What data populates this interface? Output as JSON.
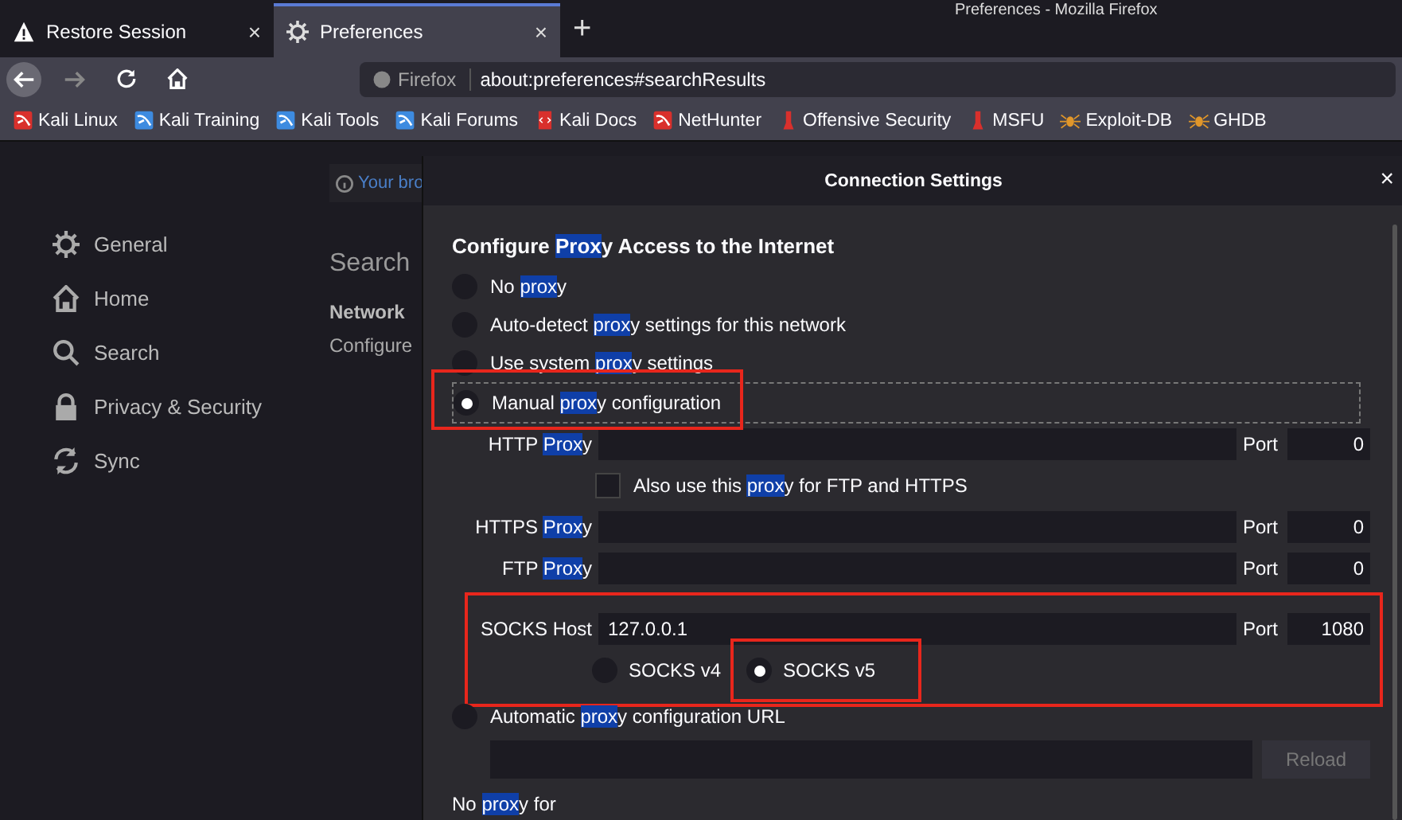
{
  "window": {
    "title": "Preferences - Mozilla Firefox"
  },
  "tabs": [
    {
      "label": "Restore Session",
      "kind": "warning",
      "selected": false,
      "close": "×"
    },
    {
      "label": "Preferences",
      "kind": "gear",
      "selected": true,
      "close": "×"
    }
  ],
  "new_tab": "+",
  "url_bar": {
    "identity": "Firefox",
    "url": "about:preferences#searchResults"
  },
  "bookmarks": [
    {
      "label": "Kali Linux",
      "kind": "dragon",
      "color": "#d9302c"
    },
    {
      "label": "Kali Training",
      "kind": "dragon",
      "color": "#3d8be0"
    },
    {
      "label": "Kali Tools",
      "kind": "dragon",
      "color": "#3d8be0"
    },
    {
      "label": "Kali Forums",
      "kind": "dragon",
      "color": "#3d8be0"
    },
    {
      "label": "Kali Docs",
      "kind": "doc",
      "color": "#d9302c"
    },
    {
      "label": "NetHunter",
      "kind": "dragon",
      "color": "#d9302c"
    },
    {
      "label": "Offensive Security",
      "kind": "flask",
      "color": "#d9302c"
    },
    {
      "label": "MSFU",
      "kind": "flask",
      "color": "#d9302c"
    },
    {
      "label": "Exploit-DB",
      "kind": "bug",
      "color": "#e0962a"
    },
    {
      "label": "GHDB",
      "kind": "bug",
      "color": "#e0962a"
    }
  ],
  "sidebar": {
    "items": [
      {
        "label": "General",
        "kind": "gear"
      },
      {
        "label": "Home",
        "kind": "home"
      },
      {
        "label": "Search",
        "kind": "search"
      },
      {
        "label": "Privacy & Security",
        "kind": "lock"
      },
      {
        "label": "Sync",
        "kind": "sync"
      }
    ]
  },
  "page": {
    "notice": "Your bro",
    "heading": "Search",
    "section": "Network",
    "description": "Configure"
  },
  "dialog": {
    "title": "Connection Settings",
    "close": "×",
    "heading": [
      {
        "text": "Configure ",
        "highlight": false
      },
      {
        "text": "Prox",
        "highlight": true
      },
      {
        "text": "y Access to the Internet",
        "highlight": false
      }
    ],
    "modes": [
      {
        "parts": [
          {
            "text": "No ",
            "highlight": false
          },
          {
            "text": "prox",
            "highlight": true
          },
          {
            "text": "y",
            "highlight": false
          }
        ],
        "selected": false,
        "outlined": false
      },
      {
        "parts": [
          {
            "text": "Auto-detect ",
            "highlight": false
          },
          {
            "text": "prox",
            "highlight": true
          },
          {
            "text": "y settings for this network",
            "highlight": false
          }
        ],
        "selected": false,
        "outlined": false
      },
      {
        "parts": [
          {
            "text": "Use system ",
            "highlight": false
          },
          {
            "text": "prox",
            "highlight": true
          },
          {
            "text": "y settings",
            "highlight": false
          }
        ],
        "selected": false,
        "outlined": false
      },
      {
        "parts": [
          {
            "text": "Manual ",
            "highlight": false
          },
          {
            "text": "prox",
            "highlight": true
          },
          {
            "text": "y configuration",
            "highlight": false
          }
        ],
        "selected": true,
        "outlined": true
      }
    ],
    "http": {
      "label": [
        {
          "text": "HTTP ",
          "highlight": false
        },
        {
          "text": "Prox",
          "highlight": true
        },
        {
          "text": "y",
          "highlight": false
        }
      ],
      "port_label": "Port",
      "port": "0"
    },
    "share": {
      "parts": [
        {
          "text": "Also use this ",
          "highlight": false
        },
        {
          "text": "prox",
          "highlight": true
        },
        {
          "text": "y for FTP and HTTPS",
          "highlight": false
        }
      ],
      "checked": false
    },
    "https": {
      "label": [
        {
          "text": "HTTPS ",
          "highlight": false
        },
        {
          "text": "Prox",
          "highlight": true
        },
        {
          "text": "y",
          "highlight": false
        }
      ],
      "port_label": "Port",
      "port": "0"
    },
    "ftp": {
      "label": [
        {
          "text": "FTP ",
          "highlight": false
        },
        {
          "text": "Prox",
          "highlight": true
        },
        {
          "text": "y",
          "highlight": false
        }
      ],
      "port_label": "Port",
      "port": "0"
    },
    "socks": {
      "label": "SOCKS Host",
      "value": "127.0.0.1",
      "port_label": "Port",
      "port": "1080",
      "outlined": true,
      "versions": [
        {
          "label": "SOCKS v4",
          "selected": false,
          "outlined": false
        },
        {
          "label": "SOCKS v5",
          "selected": true,
          "outlined": true
        }
      ]
    },
    "auto_url": {
      "parts": [
        {
          "text": "Automatic ",
          "highlight": false
        },
        {
          "text": "prox",
          "highlight": true
        },
        {
          "text": "y configuration URL",
          "highlight": false
        }
      ],
      "selected": false
    },
    "reload": "Reload",
    "no_proxy": [
      {
        "text": "No ",
        "highlight": false
      },
      {
        "text": "prox",
        "highlight": true
      },
      {
        "text": "y for",
        "highlight": false
      }
    ]
  }
}
